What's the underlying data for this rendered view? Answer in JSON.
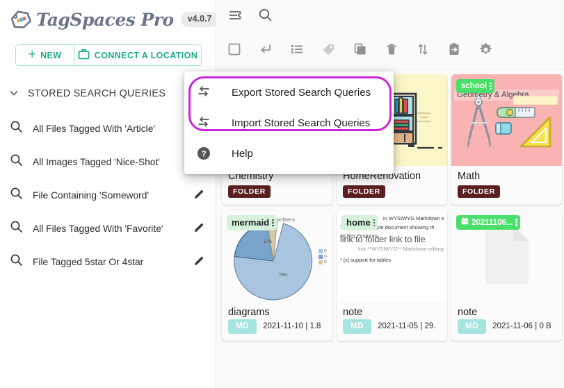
{
  "app": {
    "brand": "TagSpaces Pro",
    "version": "v4.0.7"
  },
  "sidebar": {
    "new_button": "NEW",
    "connect_button": "CONNECT A LOCATION",
    "section_title": "STORED SEARCH QUERIES",
    "queries": [
      {
        "label": "All Files Tagged With 'Article'",
        "editable": false
      },
      {
        "label": "All Images Tagged 'Nice-Shot'",
        "editable": false
      },
      {
        "label": "File Containing 'Someword'",
        "editable": true
      },
      {
        "label": "All Files Tagged With 'Favorite'",
        "editable": true
      },
      {
        "label": "File Tagged 5star Or 4star",
        "editable": true
      }
    ]
  },
  "topbar": {
    "icons": [
      "menu-collapse-icon",
      "search-icon"
    ]
  },
  "toolbar": {
    "icons": [
      "select-all-icon",
      "back-arrow-icon",
      "list-view-icon",
      "tag-icon",
      "copy-icon",
      "delete-icon",
      "sort-icon",
      "move-to-icon",
      "settings-icon"
    ]
  },
  "context_menu": {
    "items": [
      {
        "label": "Export Stored Search Queries",
        "icon": "import-export-icon",
        "highlighted": true
      },
      {
        "label": "Import Stored Search Queries",
        "icon": "import-export-icon",
        "highlighted": true
      },
      {
        "label": "Help",
        "icon": "help-icon",
        "highlighted": false
      }
    ],
    "highlight_color": "#cc22dd"
  },
  "grid": {
    "cards": [
      {
        "title": "Chemistry",
        "kind": "folder",
        "badge": "FOLDER",
        "thumb": "chemistry-lab-illustration",
        "meta": "",
        "tag": null
      },
      {
        "title": "HomeRenovation",
        "kind": "folder",
        "badge": "FOLDER",
        "thumb": "bookshelf-illustration",
        "meta": "",
        "tag": null
      },
      {
        "title": "Math",
        "kind": "folder",
        "badge": "FOLDER",
        "thumb": "geometry-tools-illustration",
        "meta": "",
        "tag": {
          "label": "school",
          "style": "green"
        },
        "overlay_title": "Geometry & Algebra"
      },
      {
        "title": "diagrams",
        "kind": "file",
        "badge": "MD",
        "thumb": "pie-chart-preview",
        "meta": "2021-11-10 | 1.8",
        "tag": {
          "label": "mermaid",
          "style": "pale"
        },
        "thumb_header": "y volunteers"
      },
      {
        "title": "note",
        "kind": "file",
        "badge": "MD",
        "thumb": "markdown-text-preview",
        "meta": "2021-11-05 | 29.",
        "tag": {
          "label": "home",
          "style": "pale"
        },
        "preview_lines": [
          "in WYSIWYG Markdown e",
          "This is an example document showing th",
          "## Key Features",
          "link to folder link to file",
          "link  **WYSIWYG** Markdown editing (c",
          "*   [x] support for tables"
        ]
      },
      {
        "title": "note",
        "kind": "file",
        "badge": "MD",
        "thumb": "empty-document-icon",
        "meta": "2021-11-06 | 0 B",
        "tag": {
          "label": "20211106...",
          "style": "green",
          "icon": "calendar-icon"
        }
      }
    ]
  },
  "chart_data": {
    "type": "pie",
    "title": "y volunteers",
    "labels": [
      "D",
      "O",
      "R"
    ],
    "values": [
      79,
      17,
      4
    ],
    "value_labels": [
      "79%",
      "17%",
      ""
    ],
    "colors": [
      "#a8c4de",
      "#7aa3cb",
      "#d8c7a8"
    ],
    "legend": "right"
  }
}
